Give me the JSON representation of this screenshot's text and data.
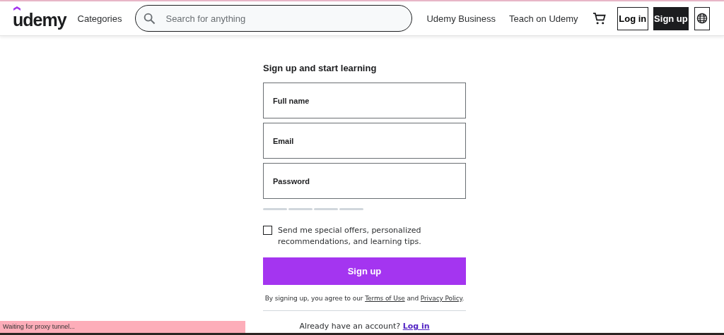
{
  "header": {
    "logo": "udemy",
    "categories": "Categories",
    "search": {
      "placeholder": "Search for anything"
    },
    "links": [
      "Udemy Business",
      "Teach on Udemy"
    ],
    "login": "Log in",
    "signup": "Sign up"
  },
  "form": {
    "title": "Sign up and start learning",
    "fields": [
      {
        "label": "Full name"
      },
      {
        "label": "Email"
      },
      {
        "label": "Password"
      }
    ],
    "strength_segments": [
      {
        "filled": false
      },
      {
        "filled": false
      },
      {
        "filled": false
      },
      {
        "filled": false
      }
    ],
    "offers": {
      "label": "Send me special offers, personalized recommendations, and learning tips.",
      "checked": false
    },
    "submit": "Sign up",
    "terms": [
      {
        "kind": "text",
        "text": "By signing up, you agree to our "
      },
      {
        "kind": "link",
        "text": "Terms of Use"
      },
      {
        "kind": "text",
        "text": " and "
      },
      {
        "kind": "link",
        "text": "Privacy Policy"
      },
      {
        "kind": "text",
        "text": "."
      }
    ],
    "login_prompt": {
      "text": "Already have an account? ",
      "link": "Log in"
    }
  },
  "status_bar": "Waiting for proxy tunnel..."
}
